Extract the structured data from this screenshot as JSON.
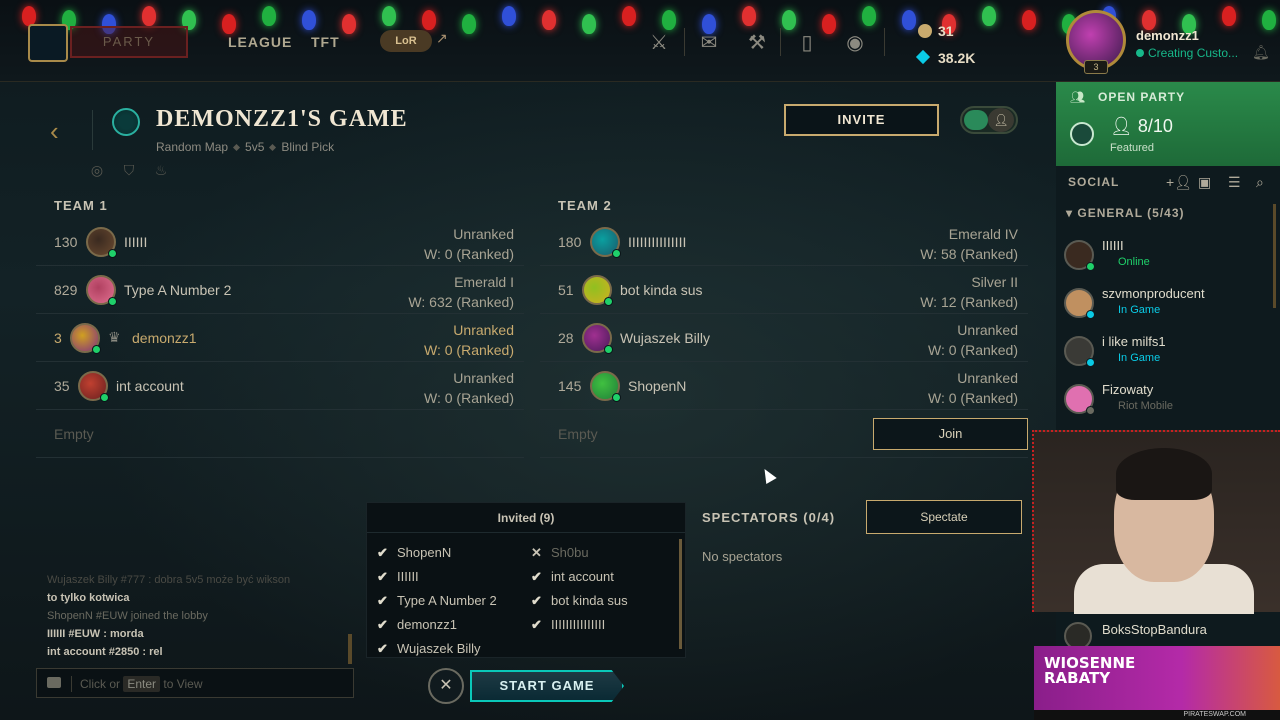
{
  "nav": {
    "party_label": "PARTY",
    "league_label": "LEAGUE",
    "tft_label": "TFT",
    "lor_label": "LoR",
    "currency_rp": "31",
    "currency_be": "38.2K",
    "summoner_name": "demonzz1",
    "summoner_status": "Creating Custo...",
    "level": "3",
    "icons": [
      "clash-icon",
      "mail-icon",
      "crafting-icon",
      "collection-icon",
      "store-icon"
    ]
  },
  "lobby": {
    "title": "DEMONZZ1'S GAME",
    "map": "Random Map",
    "mode": "5v5",
    "pick": "Blind Pick",
    "invite_label": "INVITE"
  },
  "team1": {
    "label": "TEAM 1",
    "players": [
      {
        "level": "130",
        "name": "IIIIII",
        "rank": "Unranked",
        "wins": "W: 0 (Ranked)"
      },
      {
        "level": "829",
        "name": "Type A Number 2",
        "rank": "Emerald I",
        "wins": "W: 632 (Ranked)"
      },
      {
        "level": "3",
        "name": "demonzz1",
        "rank": "Unranked",
        "wins": "W: 0 (Ranked)"
      },
      {
        "level": "35",
        "name": "int account",
        "rank": "Unranked",
        "wins": "W: 0 (Ranked)"
      }
    ],
    "empty_label": "Empty"
  },
  "team2": {
    "label": "TEAM 2",
    "players": [
      {
        "level": "180",
        "name": "IIIIIIIIIIIIIII",
        "rank": "Emerald IV",
        "wins": "W: 58 (Ranked)"
      },
      {
        "level": "51",
        "name": "bot kinda sus",
        "rank": "Silver II",
        "wins": "W: 12 (Ranked)"
      },
      {
        "level": "28",
        "name": "Wujaszek Billy",
        "rank": "Unranked",
        "wins": "W: 0 (Ranked)"
      },
      {
        "level": "145",
        "name": "ShopenN",
        "rank": "Unranked",
        "wins": "W: 0 (Ranked)"
      }
    ],
    "empty_label": "Empty",
    "join_label": "Join"
  },
  "invited": {
    "title": "Invited (9)",
    "col1": [
      {
        "mark": "✔",
        "name": "ShopenN"
      },
      {
        "mark": "✔",
        "name": "IIIIII"
      },
      {
        "mark": "✔",
        "name": "Type A Number 2"
      },
      {
        "mark": "✔",
        "name": "demonzz1"
      },
      {
        "mark": "✔",
        "name": "Wujaszek Billy"
      }
    ],
    "col2": [
      {
        "mark": "✕",
        "name": "Sh0bu"
      },
      {
        "mark": "✔",
        "name": "int account"
      },
      {
        "mark": "✔",
        "name": "bot kinda sus"
      },
      {
        "mark": "✔",
        "name": "IIIIIIIIIIIIIII"
      }
    ]
  },
  "spectators": {
    "title": "SPECTATORS (0/4)",
    "button": "Spectate",
    "empty": "No spectators"
  },
  "chat": {
    "lines": [
      {
        "text": "Wujaszek Billy #777 : dobra 5v5 może być wikson",
        "style": "faded"
      },
      {
        "text": "to tylko kotwica",
        "style": "normal"
      },
      {
        "text": "ShopenN #EUW joined the lobby",
        "style": "sys"
      },
      {
        "text": "IIIIII #EUW : morda",
        "style": "normal"
      },
      {
        "text": "int account #2850 : rel",
        "style": "normal"
      }
    ],
    "placeholder_pre": "Click or",
    "placeholder_key": "Enter",
    "placeholder_post": "to View"
  },
  "start_game_label": "START GAME",
  "social": {
    "open_party_label": "OPEN PARTY",
    "party_count": "8/10",
    "party_featured": "Featured",
    "label": "SOCIAL",
    "group_label": "GENERAL (5/43)",
    "friends": [
      {
        "name": "IIIIII",
        "status": "Online",
        "status_color": "#1fd06a"
      },
      {
        "name": "szvmonproducent",
        "status": "In Game",
        "status_color": "#0acbe6"
      },
      {
        "name": "i like milfs1",
        "status": "In Game",
        "status_color": "#0acbe6"
      },
      {
        "name": "Fizowaty",
        "status": "Riot Mobile",
        "status_color": "#6a6a60"
      }
    ],
    "bottom_friend": "BoksStopBandura"
  },
  "ad": {
    "line1": "WIOSENNE",
    "line2": "RABATY",
    "footer": "PIRATESWAP.COM"
  },
  "colors": {
    "gold": "#c8aa6e",
    "teal": "#0ac8b9",
    "online": "#1fd06a",
    "party_green": "#2a8a4a"
  }
}
